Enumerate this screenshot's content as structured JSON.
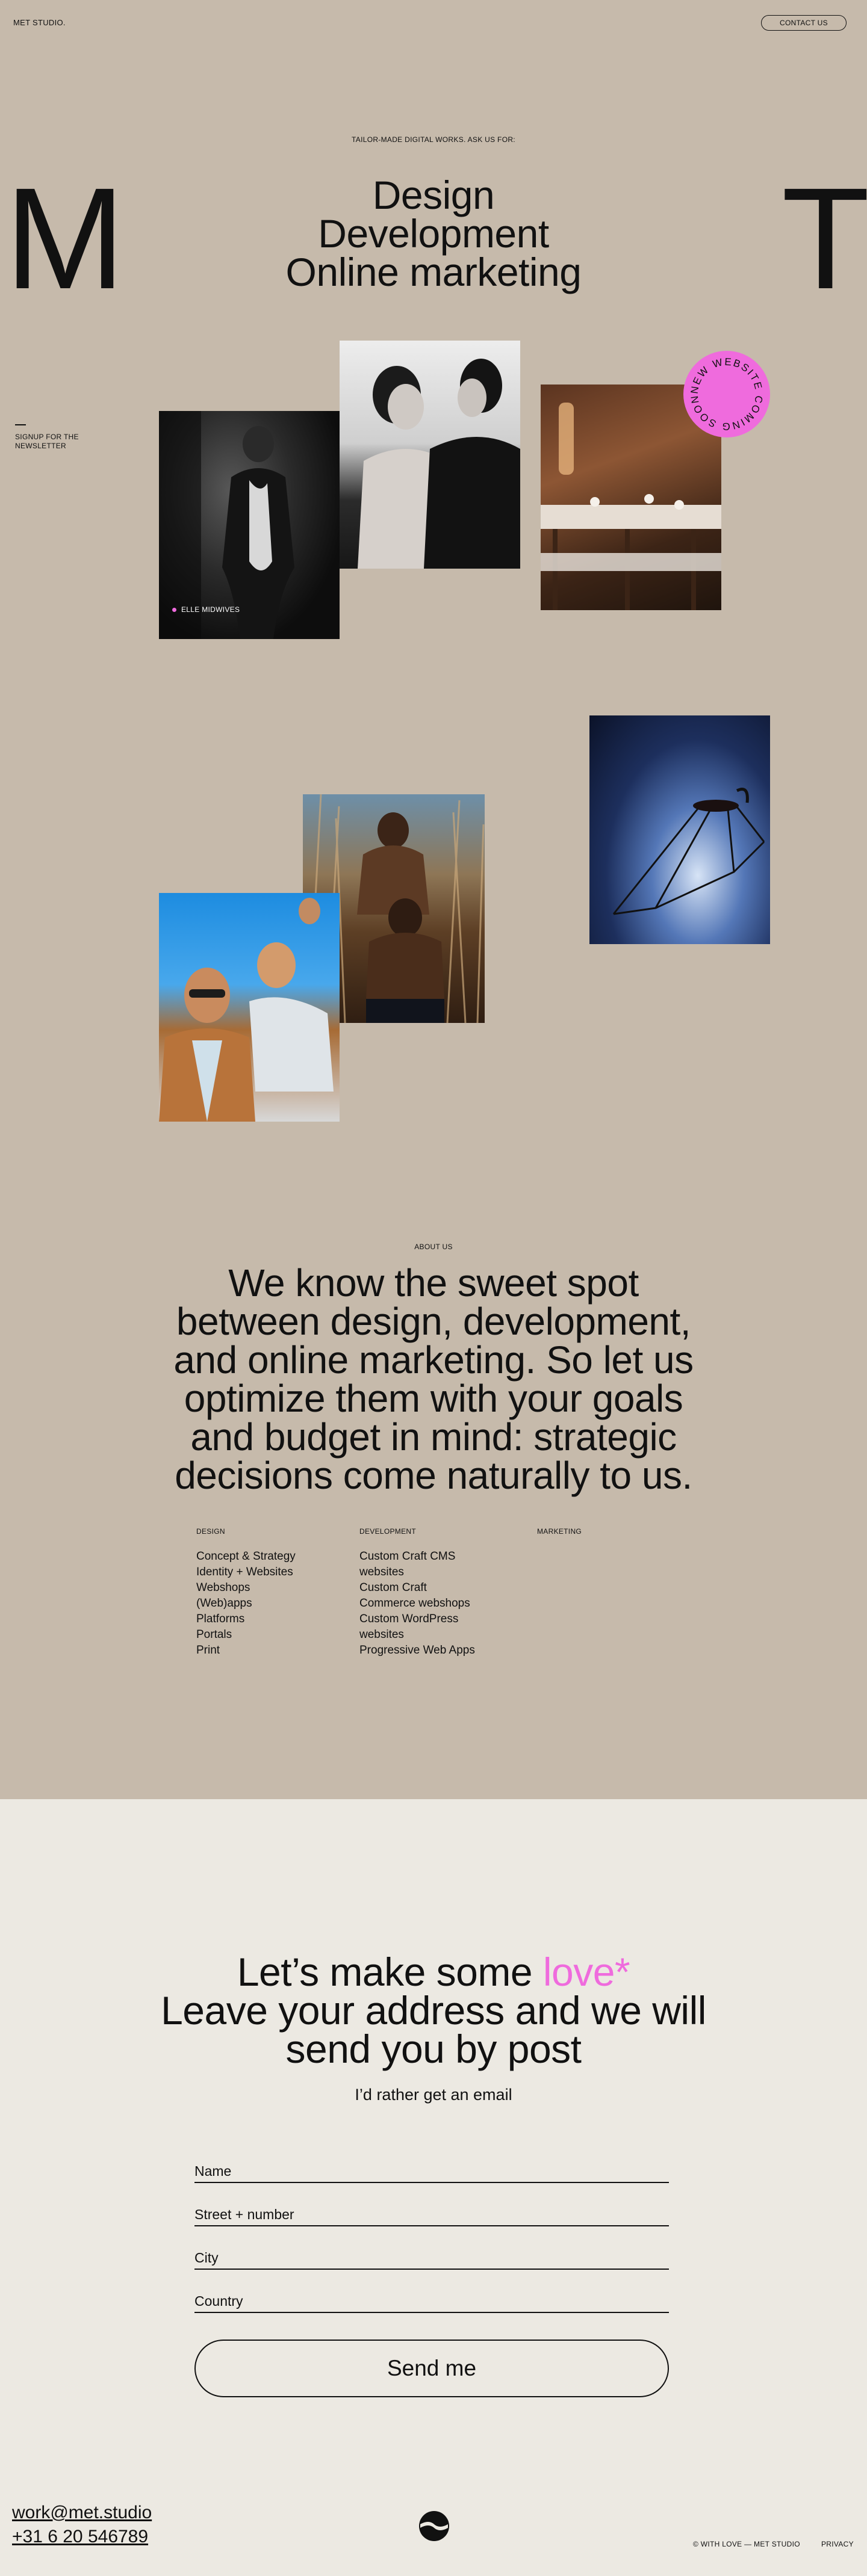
{
  "header": {
    "logo_text": "MET STUDIO.",
    "contact_label": "CONTACT US"
  },
  "hero": {
    "kicker": "TAILOR-MADE DIGITAL WORKS. ASK US FOR:",
    "services": [
      "Design",
      "Development",
      "Online marketing"
    ],
    "left_letter": "M",
    "right_letter": "T",
    "newsletter_lines": [
      "SIGNUP FOR THE",
      "NEWSLETTER"
    ],
    "photo_caption": "ELLE MIDWIVES",
    "badge_text": "NEW WEBSITE COMING SOON"
  },
  "about": {
    "kicker": "ABOUT US",
    "lines": [
      "We know the sweet spot",
      "between design, development,",
      "and online marketing. So let us",
      "optimize them with your goals",
      "and budget in mind: strategic",
      "decisions come naturally to us."
    ],
    "columns": [
      {
        "title": "DESIGN",
        "items": [
          "Concept & Strategy",
          "Identity + Websites",
          "Webshops",
          "(Web)apps",
          "Platforms",
          "Portals",
          "Print"
        ]
      },
      {
        "title": "DEVELOPMENT",
        "items": [
          "Custom Craft CMS",
          "websites",
          "Custom Craft",
          "Commerce webshops",
          "Custom WordPress",
          "websites",
          "Progressive Web Apps"
        ]
      },
      {
        "title": "MARKETING",
        "items": []
      }
    ]
  },
  "contact": {
    "title_prefix": "Let’s make some",
    "title_highlight": "love*",
    "title_line2": "Leave your address and we will",
    "title_line3": "send you by post",
    "email_alt": "I’d rather get an email",
    "fields": {
      "name": "Name",
      "street": "Street + number",
      "city": "City",
      "country": "Country"
    },
    "submit_label": "Send me"
  },
  "footer": {
    "email": "work@met.studio",
    "phone": "+31 6 20 546789",
    "credit": "© WITH LOVE — MET STUDIO",
    "privacy": "PRIVACY"
  },
  "colors": {
    "hero_bg": "#c6baab",
    "page_bg": "#ece9e2",
    "accent_pink": "#ef6bdd",
    "ink": "#111111"
  }
}
